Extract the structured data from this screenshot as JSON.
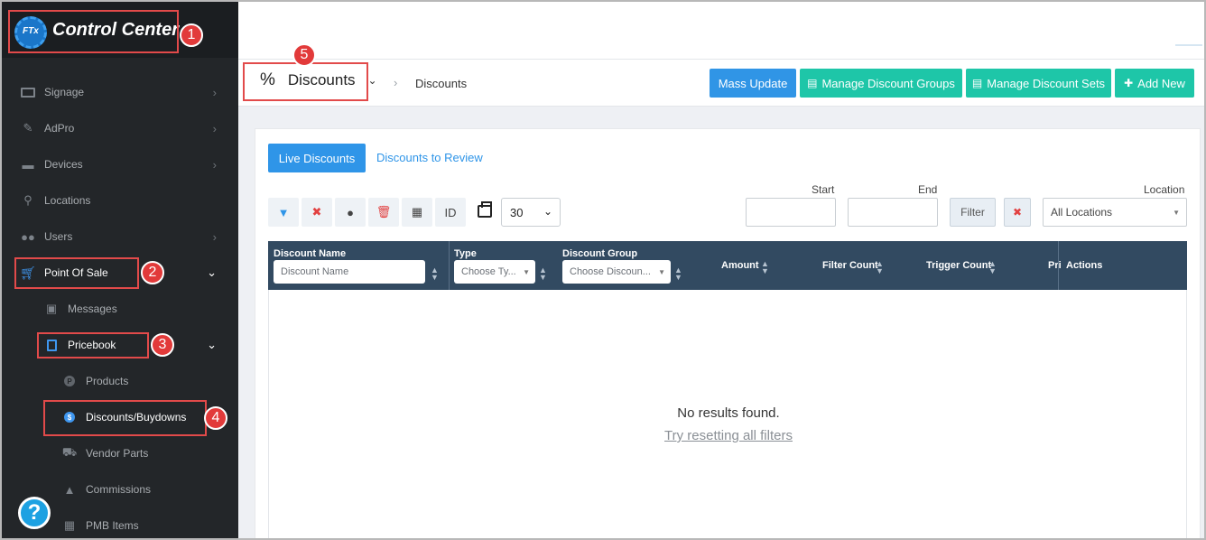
{
  "app": {
    "title": "Control Center",
    "logo_mark": "FTx"
  },
  "sidebar": {
    "items": [
      {
        "label": "Signage",
        "icon": "monitor-icon"
      },
      {
        "label": "AdPro",
        "icon": "brush-icon"
      },
      {
        "label": "Devices",
        "icon": "device-icon"
      },
      {
        "label": "Locations",
        "icon": "location-pin-icon"
      },
      {
        "label": "Users",
        "icon": "users-icon"
      },
      {
        "label": "Point Of Sale",
        "icon": "cart-icon"
      },
      {
        "label": "Messages",
        "icon": "inbox-icon"
      },
      {
        "label": "Pricebook",
        "icon": "calculator-icon"
      },
      {
        "label": "Products",
        "icon": "product-icon"
      },
      {
        "label": "Discounts/Buydowns",
        "icon": "discount-icon"
      },
      {
        "label": "Vendor Parts",
        "icon": "vendor-icon"
      },
      {
        "label": "Commissions",
        "icon": "commissions-icon"
      },
      {
        "label": "PMB Items",
        "icon": "pmb-icon"
      }
    ],
    "help_label": "?"
  },
  "annotations": [
    "1",
    "2",
    "3",
    "4",
    "5"
  ],
  "header": {
    "title": "Discounts",
    "title_icon": "%",
    "breadcrumb": "Discounts",
    "buttons": {
      "mass_update": "Mass Update",
      "manage_groups": "Manage Discount Groups",
      "manage_sets": "Manage Discount Sets",
      "add_new": "Add New"
    }
  },
  "tabs": {
    "live": "Live Discounts",
    "review": "Discounts to Review"
  },
  "toolbar": {
    "id_label": "ID",
    "page_size": "30"
  },
  "filters": {
    "start_label": "Start",
    "end_label": "End",
    "filter_label": "Filter",
    "location_label": "Location",
    "location_value": "All Locations"
  },
  "table": {
    "columns": {
      "name": "Discount Name",
      "type": "Type",
      "group": "Discount Group",
      "amount": "Amount",
      "filter_count": "Filter Count",
      "trigger_count": "Trigger Count",
      "truncated": "Pri",
      "actions": "Actions"
    },
    "placeholders": {
      "name": "Discount Name",
      "type": "Choose Ty...",
      "group": "Choose Discoun..."
    },
    "empty_message": "No results found.",
    "reset_link": "Try resetting all filters"
  },
  "colors": {
    "primary": "#2f95e8",
    "teal": "#1ec6a8",
    "sidebar": "#232629",
    "table_header": "#324a61",
    "annotation": "#e23a3a"
  }
}
